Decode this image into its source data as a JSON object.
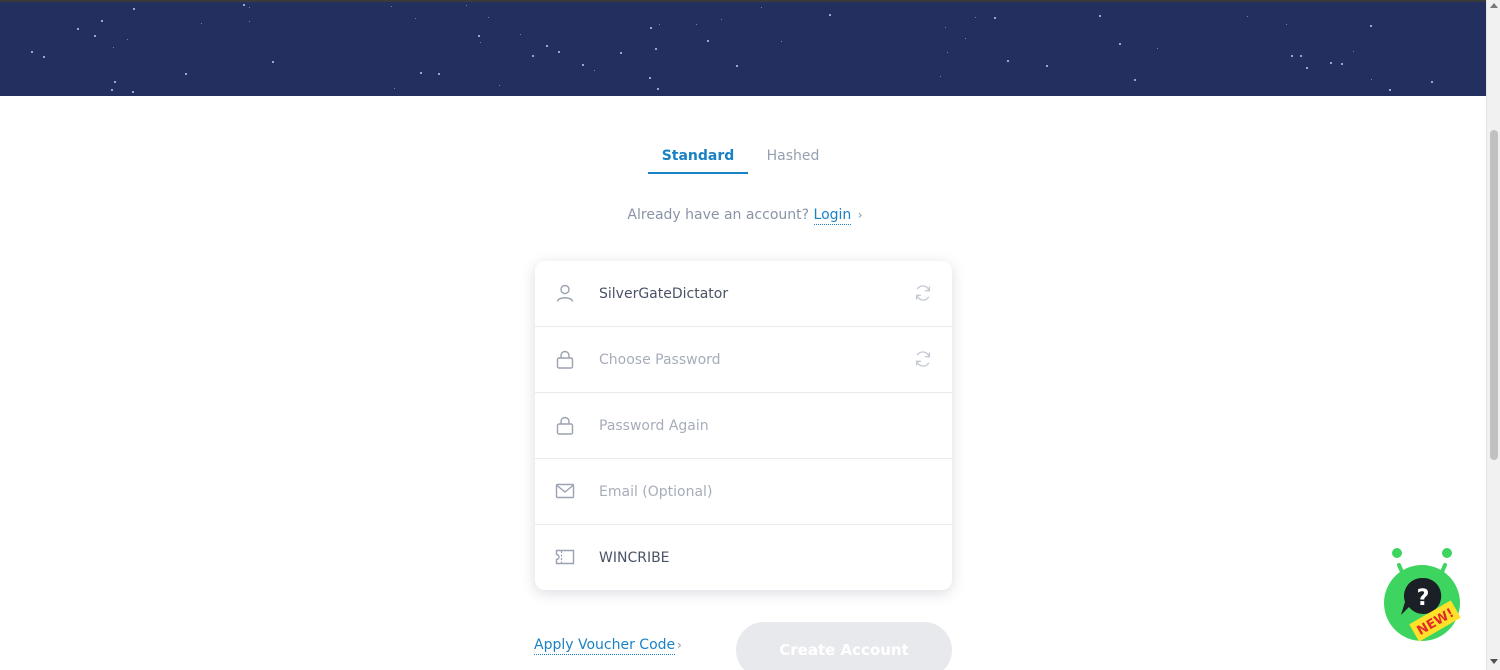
{
  "tabs": {
    "standard": "Standard",
    "hashed": "Hashed",
    "active": "Standard"
  },
  "account_prompt": {
    "text": "Already have an account?",
    "login_label": "Login",
    "chevron": "›"
  },
  "form": {
    "username": {
      "value": "SilverGateDictator",
      "icon": "user-icon"
    },
    "password": {
      "placeholder": "Choose Password",
      "icon": "lock-icon"
    },
    "password_again": {
      "placeholder": "Password Again",
      "icon": "lock-icon"
    },
    "email": {
      "placeholder": "Email (Optional)",
      "icon": "mail-icon"
    },
    "voucher": {
      "value": "WINCRIBE",
      "icon": "ticket-icon"
    }
  },
  "footer": {
    "voucher_link": "Apply Voucher Code",
    "voucher_chevron": "›",
    "create_button": "Create Account"
  },
  "help_widget": {
    "badge": "NEW!",
    "glyph": "?"
  },
  "colors": {
    "banner": "#232f5e",
    "accent": "#1a82c4",
    "muted": "#8a94a6",
    "button_disabled": "#e8e9ec",
    "bot_green": "#3ed460",
    "badge_yellow": "#ffe12a",
    "badge_red": "#e32a2a"
  }
}
